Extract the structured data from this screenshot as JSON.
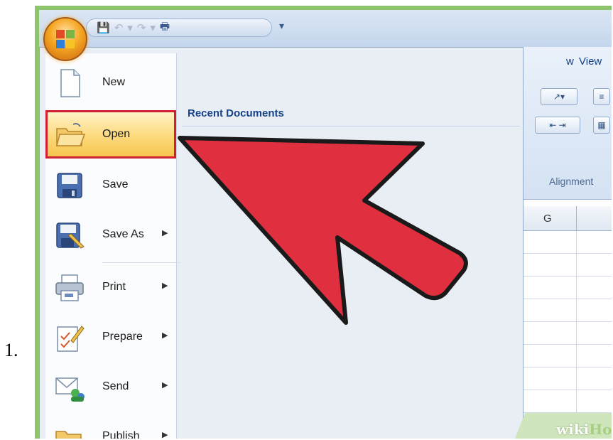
{
  "step_number": "1.",
  "ribbon": {
    "tabs": [
      "w",
      "View"
    ],
    "group_label": "Alignment",
    "column_header": "G"
  },
  "office_menu": {
    "items": [
      {
        "label": "New",
        "icon": "new-document-icon",
        "has_submenu": false
      },
      {
        "label": "Open",
        "icon": "open-folder-icon",
        "has_submenu": false,
        "selected": true
      },
      {
        "label": "Save",
        "icon": "save-floppy-icon",
        "has_submenu": false
      },
      {
        "label": "Save As",
        "icon": "save-as-icon",
        "has_submenu": true
      },
      {
        "label": "Print",
        "icon": "printer-icon",
        "has_submenu": true
      },
      {
        "label": "Prepare",
        "icon": "prepare-icon",
        "has_submenu": true
      },
      {
        "label": "Send",
        "icon": "send-icon",
        "has_submenu": true
      },
      {
        "label": "Publish",
        "icon": "publish-icon",
        "has_submenu": true
      }
    ],
    "recent_documents_title": "Recent Documents"
  },
  "watermark": {
    "part1": "wiki",
    "part2": "How"
  },
  "colors": {
    "highlight_border": "#d01f2e",
    "pointer_arrow": "#e03040",
    "frame_green": "#8fc46f"
  }
}
